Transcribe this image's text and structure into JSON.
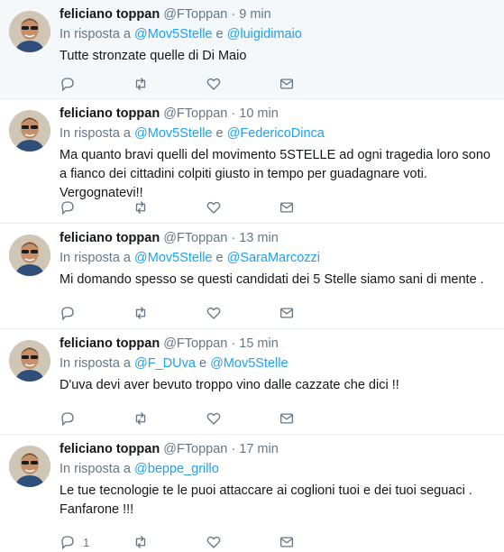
{
  "tweets": [
    {
      "name": "feliciano toppan",
      "handle": "@FToppan",
      "time": "9 min",
      "reply_prefix": "In risposta a",
      "reply_to": [
        "@Mov5Stelle",
        "@luigidimaio"
      ],
      "conj": "e",
      "text": "Tutte stronzate quelle di Di Maio",
      "reply_count": ""
    },
    {
      "name": "feliciano toppan",
      "handle": "@FToppan",
      "time": "10 min",
      "reply_prefix": "In risposta a",
      "reply_to": [
        "@Mov5Stelle",
        "@FedericoDinca"
      ],
      "conj": "e",
      "text": "Ma quanto bravi quelli del movimento 5STELLE ad ogni tragedia loro sono a fianco dei cittadini colpiti giusto in tempo per guadagnare voti. Vergognatevi!!",
      "reply_count": ""
    },
    {
      "name": "feliciano toppan",
      "handle": "@FToppan",
      "time": "13 min",
      "reply_prefix": "In risposta a",
      "reply_to": [
        "@Mov5Stelle",
        "@SaraMarcozzi"
      ],
      "conj": "e",
      "text": "Mi domando spesso se questi candidati dei 5 Stelle siamo sani di mente .",
      "reply_count": ""
    },
    {
      "name": "feliciano toppan",
      "handle": "@FToppan",
      "time": "15 min",
      "reply_prefix": "In risposta a",
      "reply_to": [
        "@F_DUva",
        "@Mov5Stelle"
      ],
      "conj": "e",
      "text": "D'uva devi aver bevuto troppo vino dalle cazzate che dici !!",
      "reply_count": ""
    },
    {
      "name": "feliciano toppan",
      "handle": "@FToppan",
      "time": "17 min",
      "reply_prefix": "In risposta a",
      "reply_to": [
        "@beppe_grillo"
      ],
      "conj": "",
      "text": "Le tue tecnologie te le puoi attaccare ai coglioni tuoi e dei tuoi seguaci . Fanfarone !!!",
      "reply_count": "1"
    }
  ],
  "separator_dot": "·",
  "icons": [
    "reply-icon",
    "retweet-icon",
    "like-icon",
    "direct-message-icon"
  ],
  "colors": {
    "link": "#1da1f2",
    "meta": "#657786",
    "text": "#14171a",
    "highlight": "#f5f8fa"
  }
}
